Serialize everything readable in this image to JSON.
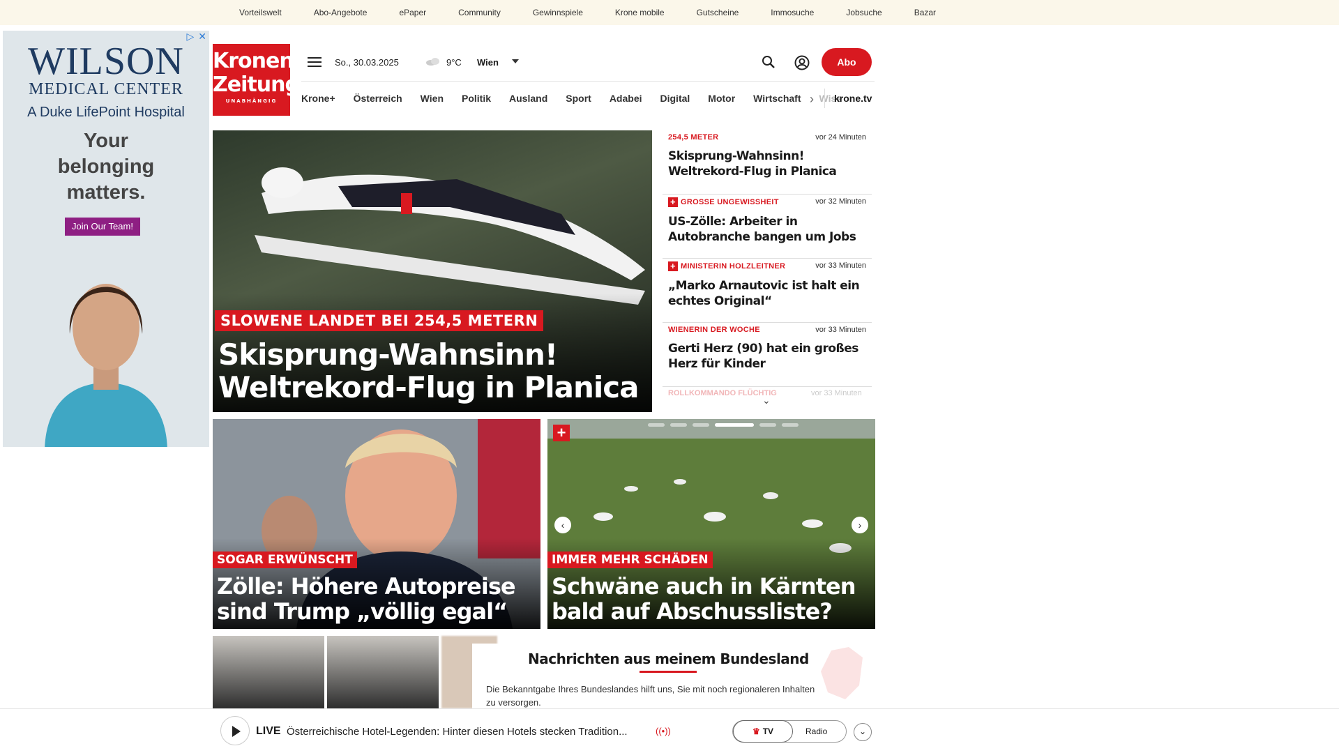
{
  "topbar": {
    "links": [
      "Vorteilswelt",
      "Abo-Angebote",
      "ePaper",
      "Community",
      "Gewinnspiele",
      "Krone mobile",
      "Gutscheine",
      "Immosuche",
      "Jobsuche",
      "Bazar"
    ]
  },
  "ad": {
    "badges": [
      "▷",
      "✕"
    ],
    "logo_line1": "WILSON",
    "logo_line2": "MEDICAL CENTER",
    "logo_line3": "A Duke LifePoint Hospital",
    "tagline": "Your belonging matters.",
    "cta": "Join Our Team!"
  },
  "header": {
    "logo_line1": "Kronen",
    "logo_line2": "Zeitung",
    "logo_line3": "UNABHÄNGIG",
    "date": "So., 30.03.2025",
    "temperature": "9°C",
    "city": "Wien",
    "abo_label": "Abo"
  },
  "nav": {
    "items": [
      "Krone+",
      "Österreich",
      "Wien",
      "Politik",
      "Ausland",
      "Sport",
      "Adabei",
      "Digital",
      "Motor",
      "Wirtschaft",
      "Wiss"
    ],
    "krone_tv": "krone.tv"
  },
  "hero": {
    "kicker": "SLOWENE LANDET BEI 254,5 METERN",
    "title_line1": "Skisprung-Wahnsinn!",
    "title_line2": "Weltrekord-Flug in Planica"
  },
  "news_list": [
    {
      "kicker": "254,5 METER",
      "time": "vor 24 Minuten",
      "title": "Skisprung-Wahnsinn! Weltrekord-Flug in Planica",
      "plus": false
    },
    {
      "kicker": "GROSSE UNGEWISSHEIT",
      "time": "vor 32 Minuten",
      "title": "US-Zölle: Arbeiter in Autobranche bangen um Jobs",
      "plus": true
    },
    {
      "kicker": "MINISTERIN HOLZLEITNER",
      "time": "vor 33 Minuten",
      "title": "„Marko Arnautovic ist halt ein echtes Original“",
      "plus": true
    },
    {
      "kicker": "WIENERIN DER WOCHE",
      "time": "vor 33 Minuten",
      "title": "Gerti Herz (90) hat ein großes Herz für Kinder",
      "plus": false
    }
  ],
  "news_fade": {
    "kicker": "ROLLKOMMANDO FLÜCHTIG",
    "time": "vor 33 Minuten"
  },
  "cards": [
    {
      "kicker": "SOGAR ERWÜNSCHT",
      "title_line1": "Zölle: Höhere Autopreise",
      "title_line2": "sind Trump „völlig egal“"
    },
    {
      "kicker": "IMMER MEHR SCHÄDEN",
      "title_line1": "Schwäne auch in Kärnten",
      "title_line2": "bald auf Abschussliste?"
    }
  ],
  "bundesland": {
    "title": "Nachrichten aus meinem Bundesland",
    "text": "Die Bekanntgabe Ihres Bundeslandes hilft uns, Sie mit noch regionaleren Inhalten zu versorgen."
  },
  "player": {
    "live_label": "LIVE",
    "live_text": "Österreichische Hotel-Legenden: Hinter diesen Hotels stecken Tradition...",
    "tv_label": "TV",
    "radio_label": "Radio"
  },
  "colors": {
    "brand_red": "#d81920",
    "topbar_bg": "#fbf7ea"
  }
}
